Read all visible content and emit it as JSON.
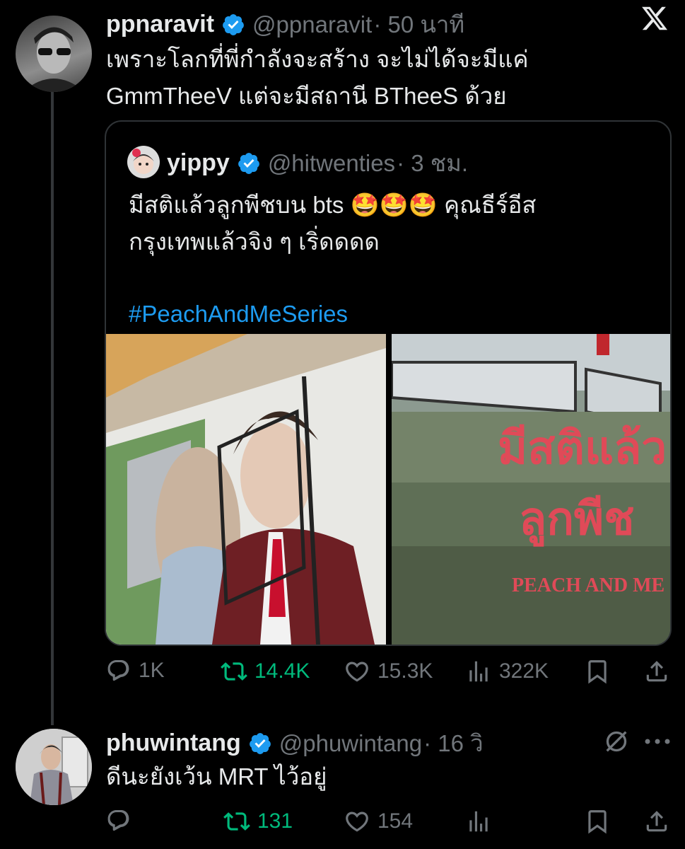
{
  "tweet": {
    "name": "ppnaravit",
    "handle": "@ppnaravit",
    "time": "· 50 นาที",
    "lines": [
      "เพราะโลกที่พี่กำลังจะสร้าง จะไม่ได้จะมีแค่",
      "GmmTheeV  แต่จะมีสถานี BTheeS ด้วย"
    ],
    "stats": {
      "reply": "1K",
      "retweet": "14.4K",
      "like": "15.3K",
      "views": "322K"
    }
  },
  "quote": {
    "name": "yippy",
    "handle": "@hitwenties",
    "time": "· 3 ชม.",
    "line1": "มีสติแล้วลูกพีชบน bts",
    "emoji": "🤩🤩🤩",
    "line1b": "คุณธีร์อีส",
    "line2": "กรุงเทพแล้วจิง ๆ เริ่ดดดด",
    "hashtag": "#PeachAndMeSeries",
    "image_text": {
      "title1": "มีสติแล้ว",
      "title2": "ลูกพีช",
      "logo": "PEACH AND ME"
    }
  },
  "reply": {
    "name": "phuwintang",
    "handle": "@phuwintang",
    "time": "· 16 วิ",
    "text": "ดีนะยังเว้น MRT ไว้อยู่",
    "stats": {
      "retweet": "131",
      "like": "154"
    }
  },
  "colors": {
    "accent": "#1d9bf0",
    "retweet": "#00ba7c",
    "muted": "#71767b",
    "background": "#000000"
  },
  "icons": [
    "x-logo-icon",
    "verified-icon",
    "reply-icon",
    "retweet-icon",
    "like-icon",
    "views-icon",
    "bookmark-icon",
    "share-icon",
    "grok-icon",
    "more-icon"
  ]
}
